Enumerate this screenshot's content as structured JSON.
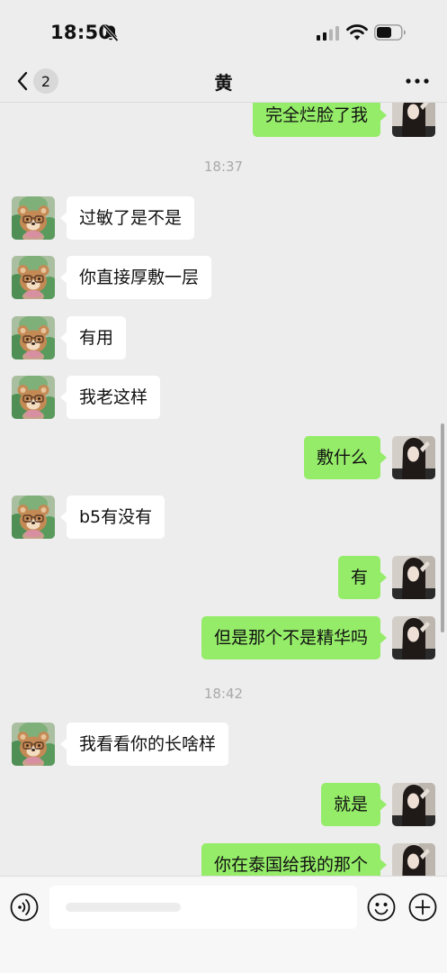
{
  "status_bar": {
    "time": "18:50",
    "icons": [
      "bell-slash-icon",
      "signal-icon",
      "wifi-icon",
      "battery-icon"
    ]
  },
  "nav": {
    "title": "黄",
    "unread_count": "2",
    "icons": [
      "chevron-left-icon",
      "more-icon"
    ]
  },
  "chat": {
    "items": [
      {
        "type": "out",
        "text": "完全烂脸了我",
        "partial": true
      },
      {
        "type": "time",
        "text": "18:37"
      },
      {
        "type": "in",
        "text": "过敏了是不是"
      },
      {
        "type": "in",
        "text": "你直接厚敷一层"
      },
      {
        "type": "in",
        "text": "有用"
      },
      {
        "type": "in",
        "text": "我老这样"
      },
      {
        "type": "out",
        "text": "敷什么"
      },
      {
        "type": "in",
        "text": "b5有没有"
      },
      {
        "type": "out",
        "text": "有"
      },
      {
        "type": "out",
        "text": "但是那个不是精华吗"
      },
      {
        "type": "time",
        "text": "18:42"
      },
      {
        "type": "in",
        "text": "我看看你的长啥样"
      },
      {
        "type": "out",
        "text": "就是"
      },
      {
        "type": "out",
        "text": "你在泰国给我的那个",
        "partial": true
      }
    ]
  },
  "input_bar": {
    "icons": [
      "voice-icon",
      "emoji-icon",
      "plus-icon"
    ]
  },
  "colors": {
    "background": "#ededed",
    "outgoing_bubble": "#95ec69",
    "incoming_bubble": "#ffffff",
    "timestamp": "#a9a9a9"
  }
}
